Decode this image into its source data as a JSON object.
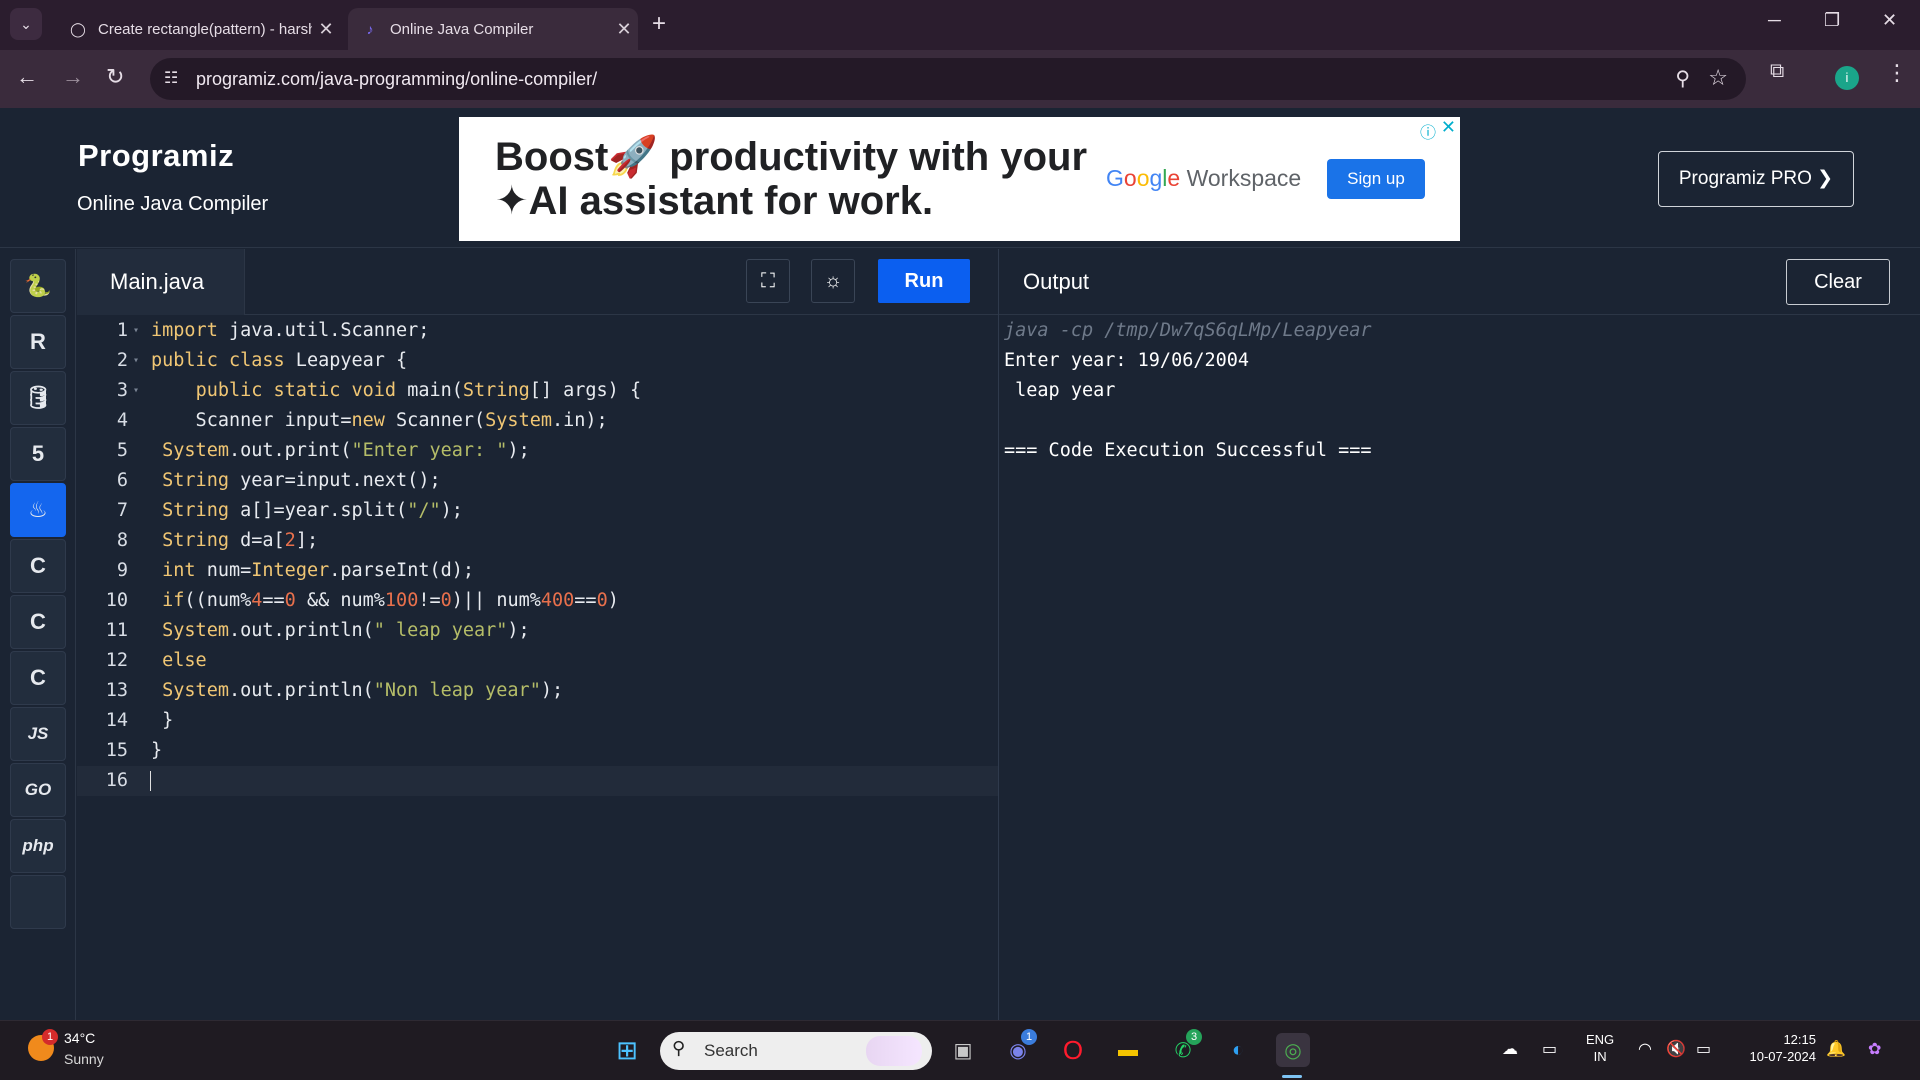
{
  "browser": {
    "tabs": [
      {
        "title": "Create rectangle(pattern) - harsh",
        "active": false
      },
      {
        "title": "Online Java Compiler",
        "active": true
      }
    ],
    "url": "programiz.com/java-programming/online-compiler/"
  },
  "header": {
    "logo": "Programiz",
    "subtitle": "Online Java Compiler",
    "pro_button": "Programiz PRO ❯"
  },
  "ad": {
    "line1": "Boost🚀 productivity with your",
    "line2": "✦AI assistant for work.",
    "brand": "Workspace",
    "cta": "Sign up"
  },
  "sidebar": {
    "languages": [
      {
        "name": "python",
        "glyph": "🐍"
      },
      {
        "name": "r",
        "glyph": "R"
      },
      {
        "name": "sql",
        "glyph": "🛢"
      },
      {
        "name": "html",
        "glyph": "5"
      },
      {
        "name": "java",
        "glyph": "♨",
        "selected": true
      },
      {
        "name": "c",
        "glyph": "C"
      },
      {
        "name": "cpp",
        "glyph": "C"
      },
      {
        "name": "csharp",
        "glyph": "C"
      },
      {
        "name": "javascript",
        "glyph": "JS"
      },
      {
        "name": "go",
        "glyph": "GO"
      },
      {
        "name": "php",
        "glyph": "php"
      }
    ]
  },
  "editor": {
    "filename": "Main.java",
    "run_label": "Run",
    "lines": [
      "import java.util.Scanner;",
      "public class Leapyear {",
      "    public static void main(String[] args) {",
      "    Scanner input=new Scanner(System.in);",
      " System.out.print(\"Enter year: \");",
      " String year=input.next();",
      " String a[]=year.split(\"/\");",
      " String d=a[2];",
      " int num=Integer.parseInt(d);",
      " if((num%4==0 && num%100!=0)|| num%400==0)",
      " System.out.println(\" leap year\");",
      " else",
      " System.out.println(\"Non leap year\");",
      " }",
      "}",
      ""
    ]
  },
  "output": {
    "title": "Output",
    "clear_label": "Clear",
    "lines": [
      {
        "text": "java -cp /tmp/Dw7qS6qLMp/Leapyear",
        "kind": "cmd"
      },
      {
        "text": "Enter year: 19/06/2004",
        "kind": "out"
      },
      {
        "text": " leap year",
        "kind": "out"
      },
      {
        "text": "",
        "kind": "out"
      },
      {
        "text": "=== Code Execution Successful ===",
        "kind": "out"
      }
    ]
  },
  "taskbar": {
    "temperature": "34°C",
    "condition": "Sunny",
    "weather_badge": "1",
    "search_placeholder": "Search",
    "teams_badge": "1",
    "whatsapp_badge": "3",
    "language_line1": "ENG",
    "language_line2": "IN",
    "time": "12:15",
    "date": "10-07-2024"
  }
}
